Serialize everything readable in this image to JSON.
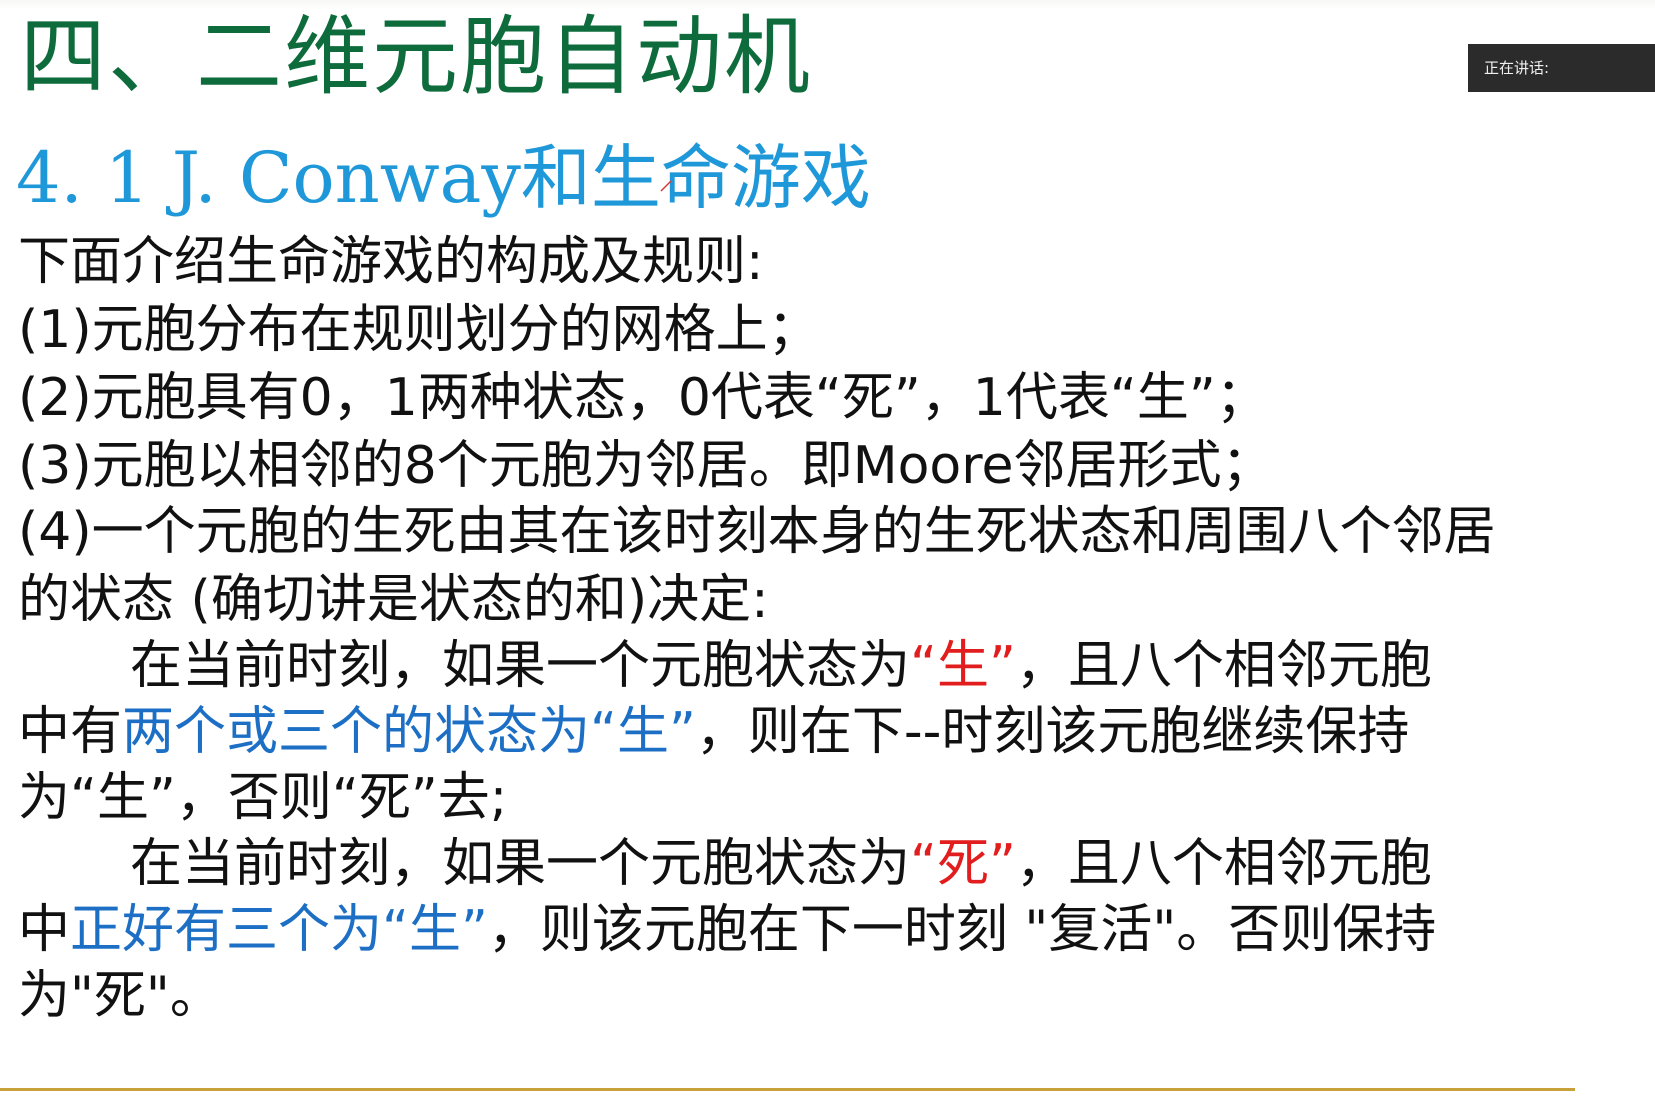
{
  "slide": {
    "title": "四、二维元胞自动机",
    "subtitle": "4. 1 J. Conway和生命游戏",
    "lines": {
      "intro": "下面介绍生命游戏的构成及规则:",
      "rule1": "(1)元胞分布在规则划分的网格上；",
      "rule2": "(2)元胞具有0，1两种状态，0代表“死”，1代表“生”；",
      "rule3": "(3)元胞以相邻的8个元胞为邻居。即Moore邻居形式；",
      "rule4a": "(4)一个元胞的生死由其在该时刻本身的生死状态和周围八个邻居",
      "rule4b": "的状态 (确切讲是状态的和)决定:",
      "p1a_pre": "在当前时刻，如果一个元胞状态为",
      "p1a_red": "“生”",
      "p1a_post": "，且八个相邻元胞",
      "p1b_pre": "中有",
      "p1b_blue": "两个或三个的状态为“生”",
      "p1b_post": "，则在下--时刻该元胞继续保持",
      "p1c": "为“生”，否则“死”去;",
      "p2a_pre": "在当前时刻，如果一个元胞状态为",
      "p2a_red": "“死”",
      "p2a_post": "，且八个相邻元胞",
      "p2b_pre": "中",
      "p2b_blue": "正好有三个为“生”",
      "p2b_post": "，则该元胞在下一时刻 \"复活\"。否则保持",
      "p2c": "为\"死\"。"
    }
  },
  "overlay": {
    "speaking_label": "正在讲话:"
  },
  "colors": {
    "title": "#0e6b3c",
    "subtitle": "#1f98d9",
    "red": "#e11d1d",
    "blue": "#1c6fc4",
    "rule": "#c8a13a"
  },
  "icons": {
    "pen_mark": "pen-annotation-icon"
  }
}
